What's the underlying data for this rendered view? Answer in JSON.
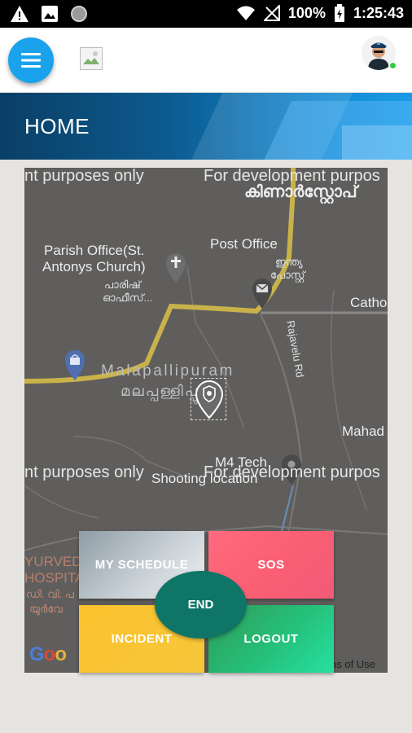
{
  "status_bar": {
    "battery": "100%",
    "time": "1:25:43",
    "icons": [
      "warning-icon",
      "image-icon",
      "circle-icon",
      "wifi-icon",
      "no-signal-icon",
      "battery-charging-icon"
    ]
  },
  "app_bar": {
    "menu_icon": "hamburger-menu-icon",
    "logo_icon": "broken-image-icon",
    "avatar_icon": "officer-avatar-icon",
    "online_color": "#2ecc40",
    "accent": "#1aa3ec"
  },
  "banner": {
    "title": "HOME"
  },
  "map": {
    "watermark_1": "nt purposes only",
    "watermark_2": "For development purpos",
    "watermark_3": "nt purposes only",
    "watermark_4": "For development purpos",
    "places": {
      "kinar_ml": "കിണാർസ്റ്റോപ്",
      "parish": "Parish Office(St.",
      "parish2": "Antonys Church)",
      "parish_ml": "പാരിഷ്",
      "parish_ml2": "ഓഫീസ്...",
      "post_office": "Post Office",
      "post_ml": "ഇന്ത്യ",
      "post_ml2": "പോസ്റ്റ്",
      "catho": "Catho",
      "malapallipuram": "Malapallipuram",
      "malapallipuram_ml": "മലപ്പള്ളിപ്പുറം",
      "rajavelu": "Rajavelu Rd",
      "mahad": "Mahad",
      "m4tech": "M4 Tech",
      "shooting": "Shooting location",
      "ayurved": "YURVED",
      "hospita": "HOSPITA",
      "ml_road": "ഡി. വി. പ",
      "ml_road2": "യുർവേ"
    },
    "google_label": "Google",
    "terms": "ns of Use"
  },
  "actions": {
    "schedule": "MY SCHEDULE",
    "sos": "SOS",
    "end": "END",
    "incident": "INCIDENT",
    "logout": "LOGOUT"
  }
}
